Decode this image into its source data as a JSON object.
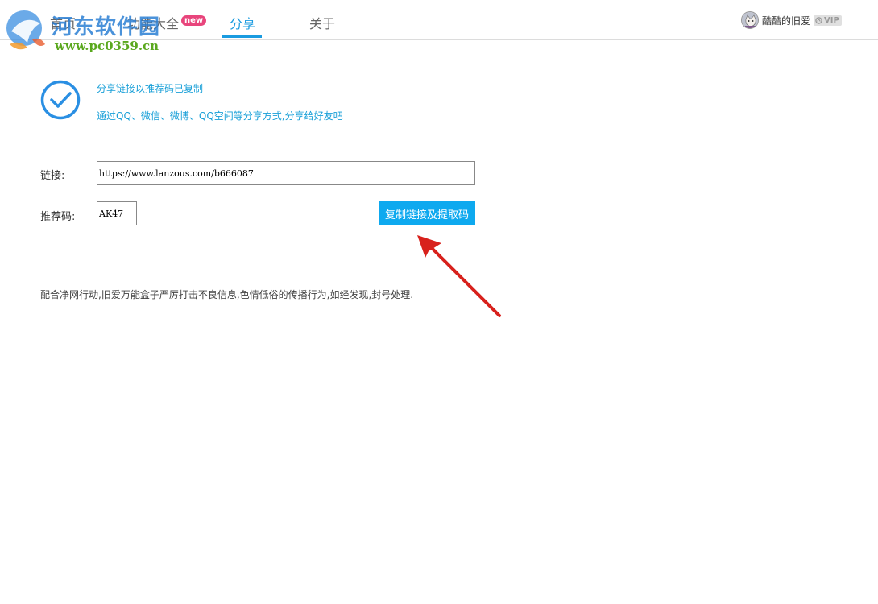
{
  "header": {
    "tabs": [
      {
        "label": "首页"
      },
      {
        "label": "功能大全"
      },
      {
        "label": "分享",
        "active": true
      },
      {
        "label": "关于"
      }
    ],
    "new_badge": "new",
    "user": {
      "name": "酷酷的旧爱",
      "vip_label": "VIP"
    }
  },
  "watermark": {
    "title": "河东软件园",
    "url": "www.pc0359.cn"
  },
  "message": {
    "line1": "分享链接以推荐码已复制",
    "line2": "通过QQ、微信、微博、QQ空间等分享方式,分享给好友吧"
  },
  "form": {
    "link_label": "链接:",
    "link_value": "https://www.lanzous.com/b666087",
    "code_label": "推荐码:",
    "code_value": "AK47",
    "copy_button": "复制链接及提取码"
  },
  "notice": "配合净网行动,旧爱万能盒子严厉打击不良信息,色情低俗的传播行为,如经发现,封号处理.",
  "colors": {
    "accent": "#1a9be0",
    "button": "#0ea9ef",
    "badge": "#e8457c",
    "arrow": "#d8211c"
  }
}
